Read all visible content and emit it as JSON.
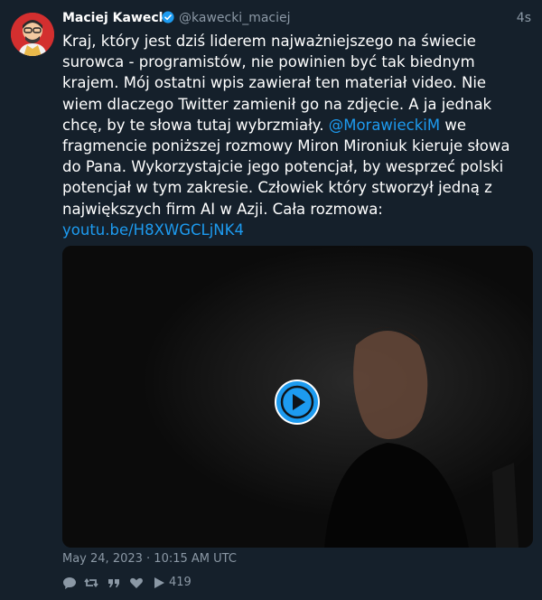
{
  "author": {
    "name": "Maciej Kawecki",
    "handle": "@kawecki_maciej",
    "time": "4s"
  },
  "tweet": {
    "text_main": "Kraj, który jest dziś liderem najważniejszego na świecie surowca - programistów, nie powinien być tak biednym krajem. Mój ostatni wpis zawierał ten materiał video. Nie wiem dlaczego Twitter zamienił go na zdjęcie. A ja jednak chcę, by te słowa tutaj wybrzmiały. ",
    "mention": "@MorawieckiM",
    "text_after_mention": " we fragmencie poniższej rozmowy Miron Mironiuk kieruje słowa do Pana. Wykorzystajcie jego potencjał, by wesprzeć polski potencjał w tym zakresie. Człowiek który stworzył jedną z największych firm AI w Azji. Cała rozmowa:",
    "link": "youtu.be/H8XWGCLjNK4"
  },
  "footer": {
    "date": "May 24, 2023 · 10:15 AM UTC",
    "views": "419"
  },
  "colors": {
    "background": "#15202b",
    "accent": "#1d9bf0",
    "muted": "#8b98a5"
  },
  "icons": [
    "verified-badge-icon",
    "reply-icon",
    "retweet-icon",
    "quote-icon",
    "like-icon",
    "views-play-icon",
    "video-play-icon"
  ]
}
